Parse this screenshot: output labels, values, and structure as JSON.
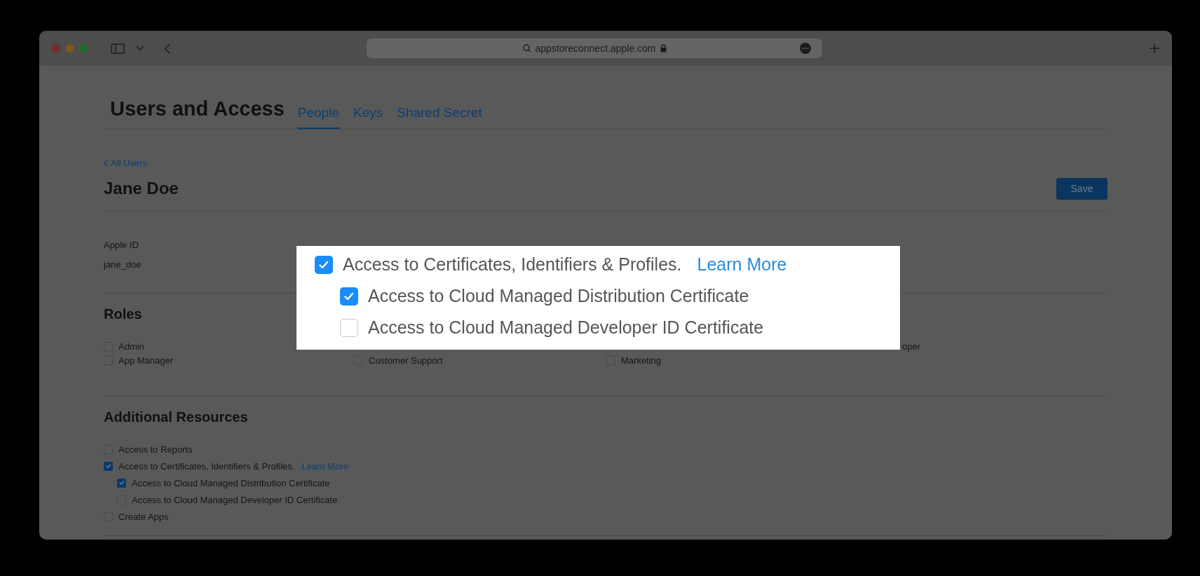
{
  "browser": {
    "address": "appstoreconnect.apple.com"
  },
  "header": {
    "title": "Users and Access",
    "tabs": [
      {
        "label": "People",
        "selected": true
      },
      {
        "label": "Keys",
        "selected": false
      },
      {
        "label": "Shared Secret",
        "selected": false
      }
    ]
  },
  "back_link": "All Users",
  "user": {
    "name": "Jane Doe",
    "save_button": "Save"
  },
  "apple_id": {
    "label": "Apple ID",
    "value": "jane_doe"
  },
  "roles": {
    "title": "Roles",
    "rows": [
      [
        {
          "kind": "checkbox",
          "label": "Admin",
          "checked": false
        },
        {
          "kind": "fragment",
          "label": "oper"
        }
      ],
      [
        {
          "kind": "checkbox",
          "label": "App Manager",
          "checked": false
        },
        {
          "kind": "checkbox",
          "label": "Customer Support",
          "checked": false
        },
        {
          "kind": "checkbox",
          "label": "Marketing",
          "checked": false
        }
      ]
    ]
  },
  "additional_resources": {
    "title": "Additional Resources",
    "items": [
      {
        "label": "Access to Reports",
        "checked": false
      },
      {
        "label": "Access to Certificates, Identifiers & Profiles.",
        "link": "Learn More",
        "checked": true,
        "children": [
          {
            "label": "Access to Cloud Managed Distribution Certificate",
            "checked": true
          },
          {
            "label": "Access to Cloud Managed Developer ID Certificate",
            "checked": false
          }
        ]
      },
      {
        "label": "Create Apps",
        "checked": false
      }
    ]
  },
  "callout": {
    "items": [
      {
        "label": "Access to Certificates, Identifiers & Profiles.",
        "link": "Learn More",
        "checked": true,
        "children": [
          {
            "label": "Access to Cloud Managed Distribution Certificate",
            "checked": true
          },
          {
            "label": "Access to Cloud Managed Developer ID Certificate",
            "checked": false
          }
        ]
      }
    ]
  }
}
